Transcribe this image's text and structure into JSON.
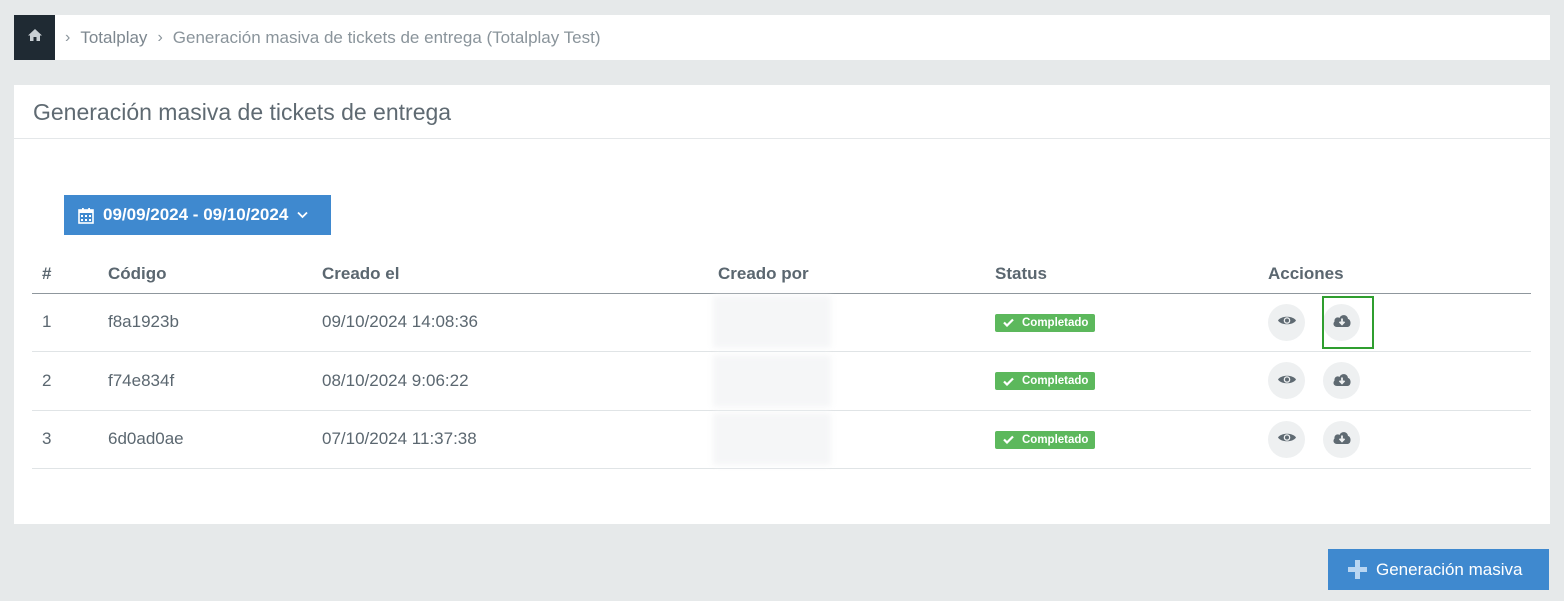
{
  "breadcrumb": {
    "home_icon": "home-icon",
    "items": [
      "Totalplay",
      "Generación masiva de tickets de entrega (Totalplay Test)"
    ]
  },
  "panel": {
    "title": "Generación masiva de tickets de entrega"
  },
  "date_filter": {
    "value": "09/09/2024 - 09/10/2024",
    "icon": "calendar-icon"
  },
  "table": {
    "columns": [
      "#",
      "Código",
      "Creado el",
      "Creado por",
      "Status",
      "Acciones"
    ],
    "rows": [
      {
        "num": "1",
        "code": "f8a1923b",
        "created_at": "09/10/2024 14:08:36",
        "created_by": "",
        "status": "Completado"
      },
      {
        "num": "2",
        "code": "f74e834f",
        "created_at": "08/10/2024 9:06:22",
        "created_by": "",
        "status": "Completado"
      },
      {
        "num": "3",
        "code": "6d0ad0ae",
        "created_at": "07/10/2024 11:37:38",
        "created_by": "",
        "status": "Completado"
      }
    ]
  },
  "actions": {
    "view_icon": "eye-icon",
    "download_icon": "cloud-download-icon"
  },
  "footer": {
    "generate_label": "Generación masiva"
  },
  "colors": {
    "primary": "#3f89cf",
    "success": "#5cb85c",
    "highlight": "#2f9e2f",
    "home_bg": "#1f2a33"
  }
}
